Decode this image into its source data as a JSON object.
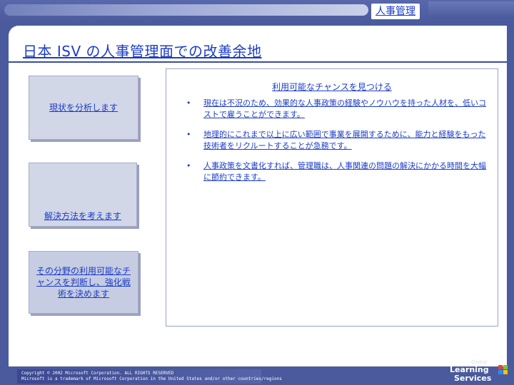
{
  "header": {
    "section_label": "人事管理"
  },
  "slide": {
    "title": "日本 ISV の人事管理面での改善余地",
    "steps": [
      {
        "label": "現状を分析します"
      },
      {
        "label": "解決方法を考えます"
      },
      {
        "label": "その分野の利用可能なチャンスを判断し、強化戦術を決めます"
      }
    ],
    "panel": {
      "title": "利用可能なチャンスを見つける",
      "bullet_marker": "•",
      "bullets": [
        "現在は不況のため、効果的な人事政策の経験やノウハウを持った人材を、低いコストで雇うことができます。",
        "地理的にこれまで以上に広い範囲で事業を展開するために、能力と経験をもった技術者をリクルートすることが急務です。",
        "人事政策を文書化すれば、管理職は、人事関連の問題の解決にかかる時間を大幅に節約できます。"
      ]
    }
  },
  "footer": {
    "line1": "Copyright © 2002 Microsoft Corporation. ALL RIGHTS RESERVED",
    "line2": "Microsoft is a trademark of Microsoft Corporation in the United States and/or other countries/regions"
  },
  "logo": {
    "line_top": "Global",
    "line_1": "Learning",
    "line_2": "Services",
    "icon": "windows-flag-icon"
  },
  "colors": {
    "background": "#4a5a9c",
    "text_accent": "#1c3cc8",
    "step_fill": "#d2d7e8"
  }
}
